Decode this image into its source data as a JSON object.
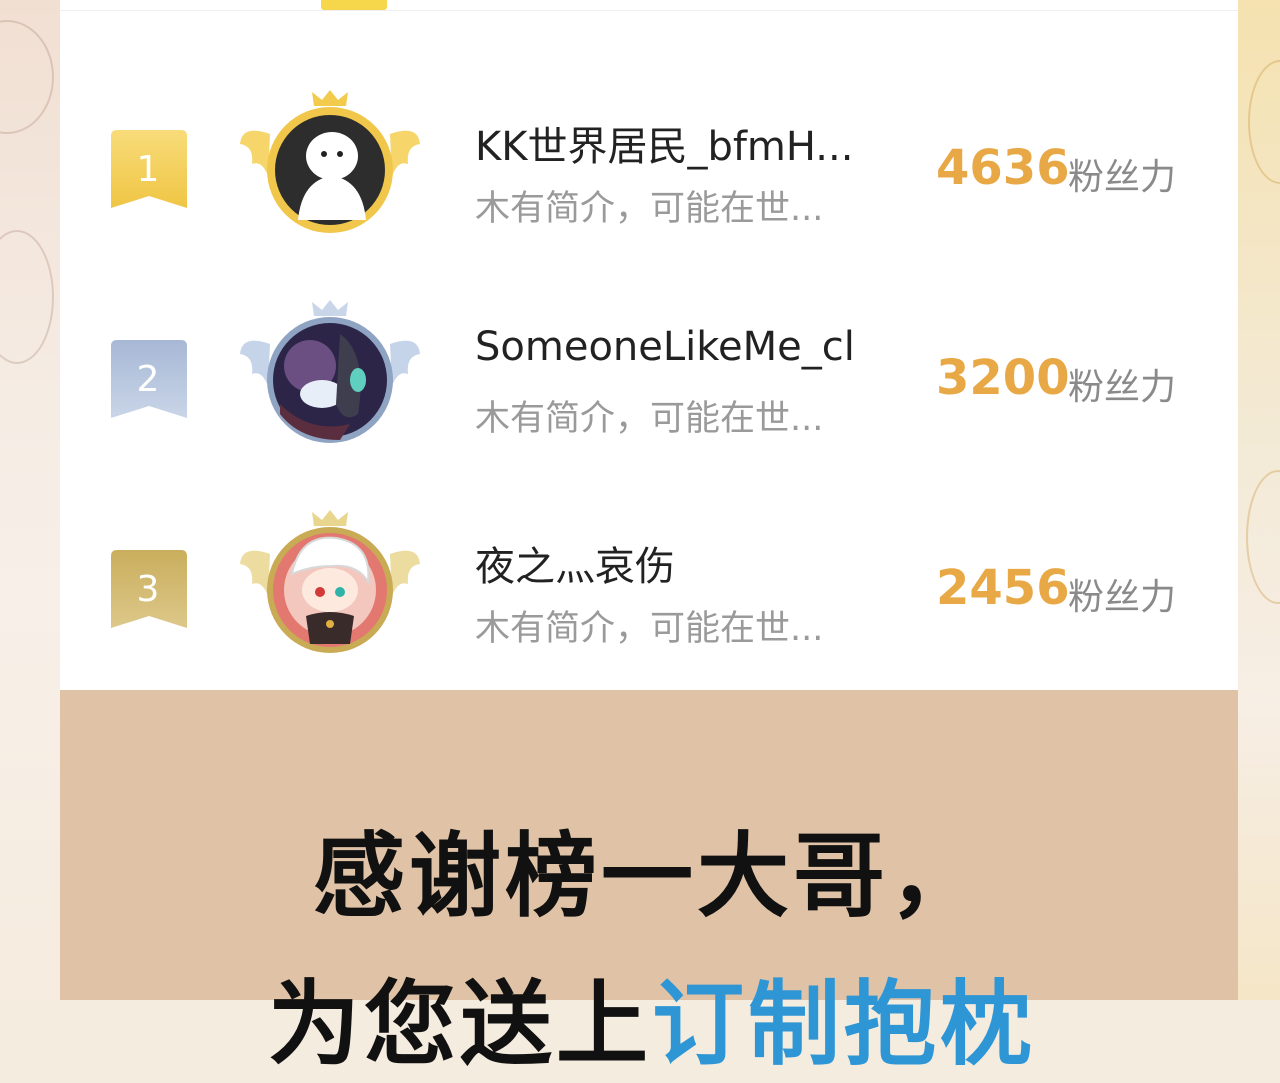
{
  "ranking": [
    {
      "rank": "1",
      "nickname": "KK世界居民_bfmH...",
      "bio": "木有简介，可能在世...",
      "score": "4636",
      "unit": "粉丝力",
      "badge_color": "#f3c94f",
      "avatar_icon": "white-ghost-avatar"
    },
    {
      "rank": "2",
      "nickname": "SomeoneLikeMe_cl",
      "bio": "木有简介，可能在世...",
      "score": "3200",
      "unit": "粉丝力",
      "badge_color": "#a9bbd8",
      "avatar_icon": "dark-fantasy-avatar"
    },
    {
      "rank": "3",
      "nickname": "夜之灬哀伤",
      "bio": "木有简介，可能在世...",
      "score": "2456",
      "unit": "粉丝力",
      "badge_color": "#cdb464",
      "avatar_icon": "anime-character-avatar"
    }
  ],
  "banner": {
    "line1": "感谢榜一大哥，",
    "line2_prefix": "为您送上",
    "line2_highlight": "订制抱枕"
  },
  "colors": {
    "accent": "#f6d64a",
    "score": "#e8a845",
    "banner_bg": "#e0c2a6",
    "highlight": "#2f96d6"
  }
}
